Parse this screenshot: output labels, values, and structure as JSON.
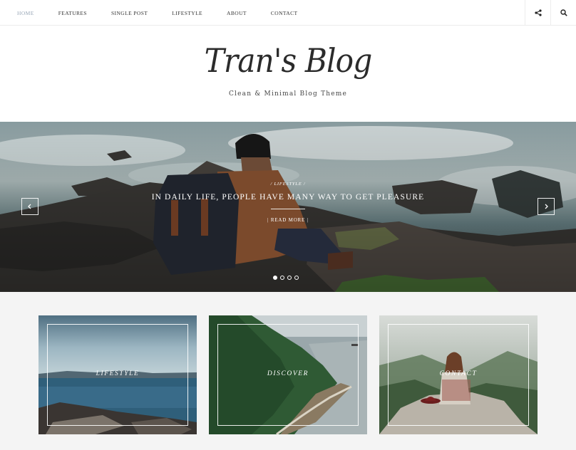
{
  "nav": {
    "items": [
      {
        "label": "HOME",
        "active": true
      },
      {
        "label": "FEATURES",
        "active": false
      },
      {
        "label": "SINGLE POST",
        "active": false
      },
      {
        "label": "LIFESTYLE",
        "active": false
      },
      {
        "label": "ABOUT",
        "active": false
      },
      {
        "label": "CONTACT",
        "active": false
      }
    ],
    "icons": [
      "share-icon",
      "search-icon"
    ],
    "active_color": "#9aa8b8"
  },
  "header": {
    "logo": "Tran's Blog",
    "tagline": "Clean & Minimal Blog Theme"
  },
  "slider": {
    "category": "/ LIFESTYLE /",
    "title": "IN DAILY LIFE, PEOPLE HAVE MANY WAY TO GET PLEASURE",
    "read_more": "| READ MORE |",
    "slide_count": 4,
    "active_slide": 1,
    "prev_icon": "chevron-left-icon",
    "next_icon": "chevron-right-icon"
  },
  "cards": [
    {
      "label": "LIFESTYLE"
    },
    {
      "label": "DISCOVER"
    },
    {
      "label": "CONTACT"
    }
  ]
}
